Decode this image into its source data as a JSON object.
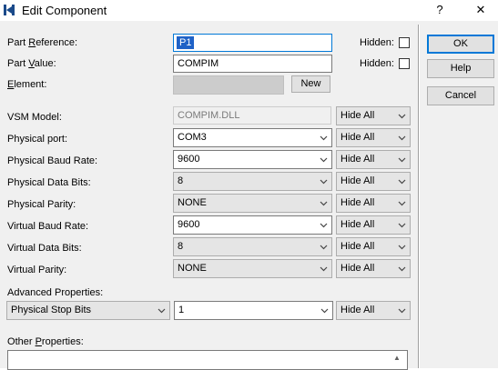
{
  "window": {
    "title": "Edit Component",
    "help_glyph": "?",
    "close_glyph": "✕"
  },
  "fields": {
    "part_reference": {
      "label_pre": "Part ",
      "label_u": "R",
      "label_post": "eference:",
      "value": "P1"
    },
    "part_value": {
      "label_pre": "Part ",
      "label_u": "V",
      "label_post": "alue:",
      "value": "COMPIM"
    },
    "element": {
      "label_u": "E",
      "label_post": "lement:",
      "value": ""
    },
    "hidden_label": "Hidden:",
    "new_label": "New"
  },
  "buttons": {
    "ok": "OK",
    "help": "Help",
    "cancel": "Cancel"
  },
  "properties": [
    {
      "label": "VSM Model:",
      "value": "COMPIM.DLL",
      "kind": "readonly",
      "vis": "Hide All"
    },
    {
      "label": "Physical port:",
      "value": "COM3",
      "kind": "white",
      "vis": "Hide All"
    },
    {
      "label": "Physical Baud Rate:",
      "value": "9600",
      "kind": "white",
      "vis": "Hide All"
    },
    {
      "label": "Physical Data Bits:",
      "value": "8",
      "kind": "grey",
      "vis": "Hide All"
    },
    {
      "label": "Physical Parity:",
      "value": "NONE",
      "kind": "grey",
      "vis": "Hide All"
    },
    {
      "label": "Virtual Baud Rate:",
      "value": "9600",
      "kind": "white",
      "vis": "Hide All"
    },
    {
      "label": "Virtual Data Bits:",
      "value": "8",
      "kind": "grey",
      "vis": "Hide All"
    },
    {
      "label": "Virtual Parity:",
      "value": "NONE",
      "kind": "grey",
      "vis": "Hide All"
    }
  ],
  "advanced": {
    "label": "Advanced Properties:",
    "property": "Physical Stop Bits",
    "value": "1",
    "vis": "Hide All"
  },
  "other": {
    "label_u": "O",
    "label_pre": "ther ",
    "label_u2": "P",
    "label_post": "roperties:"
  }
}
